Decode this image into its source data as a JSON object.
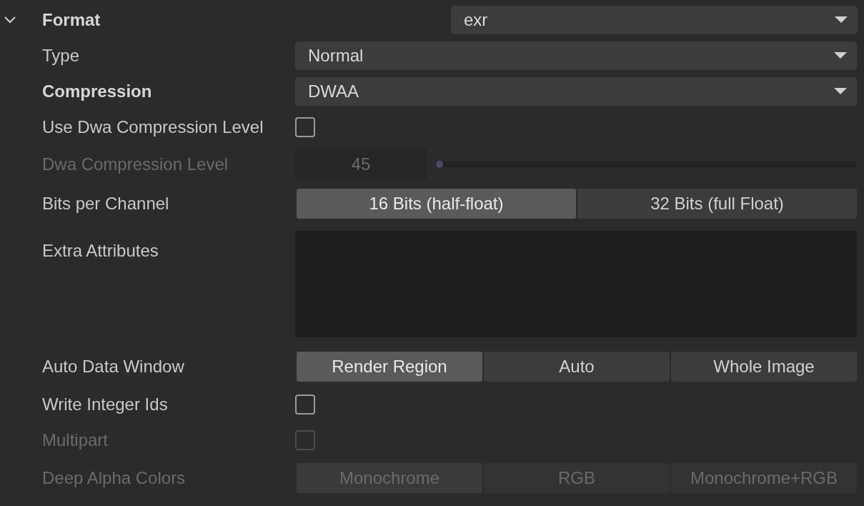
{
  "section": {
    "title": "Format",
    "expanded": true,
    "value": "exr",
    "rows": [
      {
        "kind": "dropdown",
        "label": "Type",
        "bold": false,
        "disabled": false,
        "value": "Normal"
      },
      {
        "kind": "dropdown",
        "label": "Compression",
        "bold": true,
        "disabled": false,
        "value": "DWAA"
      },
      {
        "kind": "checkbox",
        "label": "Use Dwa Compression Level",
        "bold": false,
        "disabled": false,
        "checked": false
      },
      {
        "kind": "slider",
        "label": "Dwa Compression Level",
        "bold": false,
        "disabled": true,
        "value": "45",
        "level": 0.01
      },
      {
        "kind": "segmented",
        "label": "Bits per Channel",
        "bold": false,
        "disabled": false,
        "options": [
          {
            "label": "16 Bits (half-float)",
            "selected": true
          },
          {
            "label": "32 Bits (full Float)",
            "selected": false
          }
        ]
      },
      {
        "kind": "textarea",
        "label": "Extra Attributes",
        "bold": false,
        "disabled": false
      },
      {
        "kind": "segmented",
        "label": "Auto Data Window",
        "bold": false,
        "disabled": false,
        "options": [
          {
            "label": "Render Region",
            "selected": true
          },
          {
            "label": "Auto",
            "selected": false
          },
          {
            "label": "Whole Image",
            "selected": false
          }
        ]
      },
      {
        "kind": "checkbox",
        "label": "Write Integer Ids",
        "bold": false,
        "disabled": false,
        "checked": false
      },
      {
        "kind": "checkbox",
        "label": "Multipart",
        "bold": false,
        "disabled": true,
        "checked": false
      },
      {
        "kind": "segmented",
        "label": "Deep Alpha Colors",
        "bold": false,
        "disabled": true,
        "options": [
          {
            "label": "Monochrome",
            "selected": true
          },
          {
            "label": "RGB",
            "selected": false
          },
          {
            "label": "Monochrome+RGB",
            "selected": false
          }
        ]
      }
    ]
  }
}
